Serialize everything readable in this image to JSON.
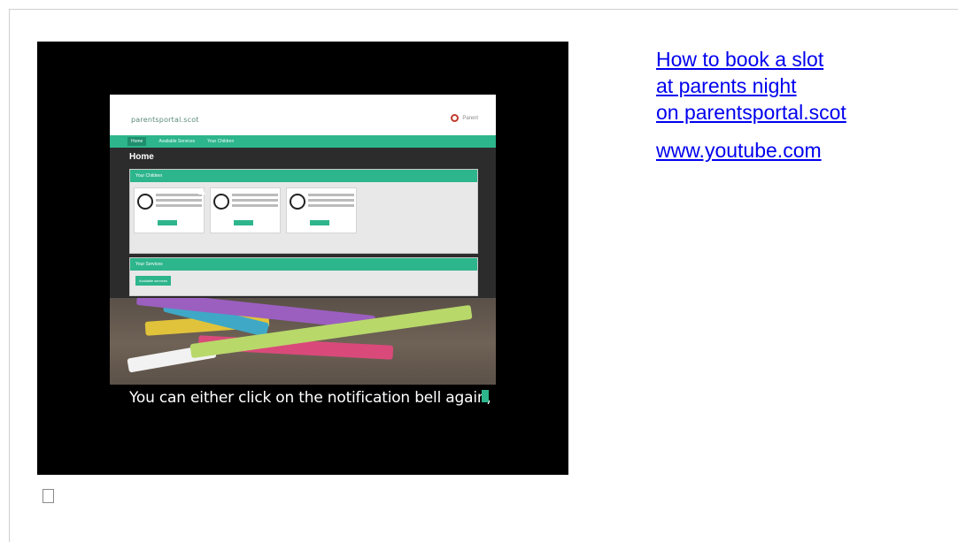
{
  "video": {
    "caption": "You can either click on the notification bell again,",
    "portal": {
      "logo_text": "parentsportal.scot",
      "user_text": "Parent",
      "nav": [
        "Home",
        "Available Services",
        "Your Children"
      ],
      "page_title": "Home",
      "children_panel_title": "Your Children",
      "bookings_panel_title": "Your Services",
      "booking_tabs": [
        "Available services",
        "",
        ""
      ]
    }
  },
  "link": {
    "title_lines": [
      "How to book a slot",
      "at parents night",
      "on parentsportal.scot"
    ],
    "source": "www.youtube.com"
  }
}
